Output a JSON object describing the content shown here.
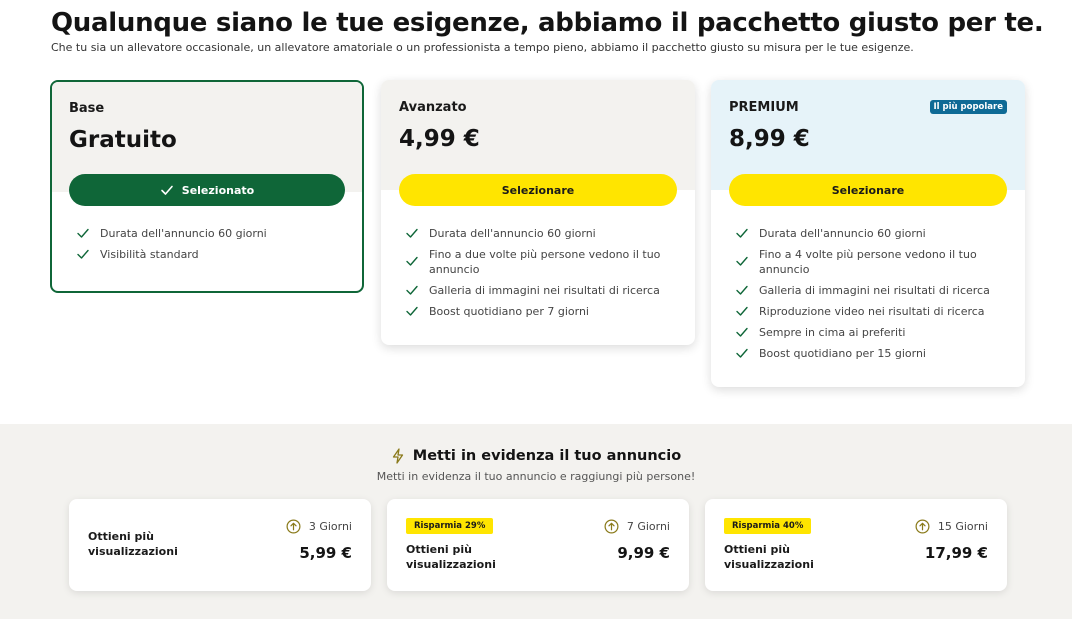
{
  "hero": {
    "title": "Qualunque siano le tue esigenze, abbiamo il pacchetto giusto per te.",
    "subtitle": "Che tu sia un allevatore occasionale, un allevatore amatoriale o un professionista a tempo pieno, abbiamo il pacchetto giusto su misura per le tue esigenze."
  },
  "plans": [
    {
      "name": "Base",
      "price": "Gratuito",
      "button": "Selezionato",
      "features": [
        "Durata dell'annuncio 60 giorni",
        "Visibilità standard"
      ]
    },
    {
      "name": "Avanzato",
      "price": "4,99 €",
      "button": "Selezionare",
      "features": [
        "Durata dell'annuncio 60 giorni",
        "Fino a due volte più persone vedono il tuo annuncio",
        "Galleria di immagini nei risultati di ricerca",
        "Boost quotidiano per 7 giorni"
      ]
    },
    {
      "name": "PREMIUM",
      "price": "8,99 €",
      "button": "Selezionare",
      "badge": "Il più popolare",
      "features": [
        "Durata dell'annuncio 60 giorni",
        "Fino a 4 volte più persone vedono il tuo annuncio",
        "Galleria di immagini nei risultati di ricerca",
        "Riproduzione video nei risultati di ricerca",
        "Sempre in cima ai preferiti",
        "Boost quotidiano per 15 giorni"
      ]
    }
  ],
  "boost": {
    "title": "Metti in evidenza il tuo annuncio",
    "subtitle": "Metti in evidenza il tuo annuncio e raggiungi più persone!",
    "options": [
      {
        "label": "Ottieni più visualizzazioni",
        "days": "3 Giorni",
        "price": "5,99 €",
        "save": ""
      },
      {
        "label": "Ottieni più visualizzazioni",
        "days": "7 Giorni",
        "price": "9,99 €",
        "save": "Risparmia 29%"
      },
      {
        "label": "Ottieni più visualizzazioni",
        "days": "15 Giorni",
        "price": "17,99 €",
        "save": "Risparmia 40%"
      }
    ]
  },
  "colors": {
    "green": "#0f6638",
    "yellow": "#ffe500",
    "badge_blue": "#0e6a96",
    "premium_bg": "#e6f3f9",
    "beige": "#f3f2ef",
    "gold_icon": "#8a7a1a"
  },
  "icons": {
    "check": "check-icon",
    "bolt": "lightning-icon",
    "arrow_up": "arrow-up-circle-icon"
  }
}
